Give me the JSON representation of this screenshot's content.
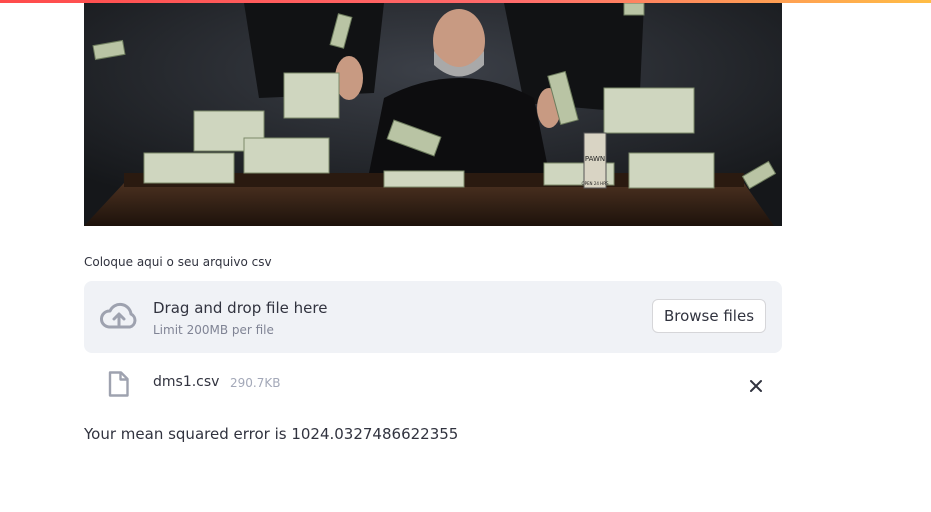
{
  "hero": {
    "sign_text": "PAWN",
    "sign_sub": "OPEN 24 HRS"
  },
  "uploader": {
    "label": "Coloque aqui o seu arquivo csv",
    "drop_text": "Drag and drop file here",
    "limit_text": "Limit 200MB per file",
    "browse_label": "Browse files",
    "icon": "cloud-upload-icon"
  },
  "file": {
    "name": "dms1.csv",
    "size": "290.7KB",
    "icon": "file-icon",
    "remove_icon": "close-icon"
  },
  "result": {
    "text": "Your mean squared error is 1024.0327486622355"
  },
  "colors": {
    "accent": "#ff4b4b",
    "dropzone_bg": "#f0f2f6",
    "text": "#31333f",
    "muted": "#808495"
  }
}
